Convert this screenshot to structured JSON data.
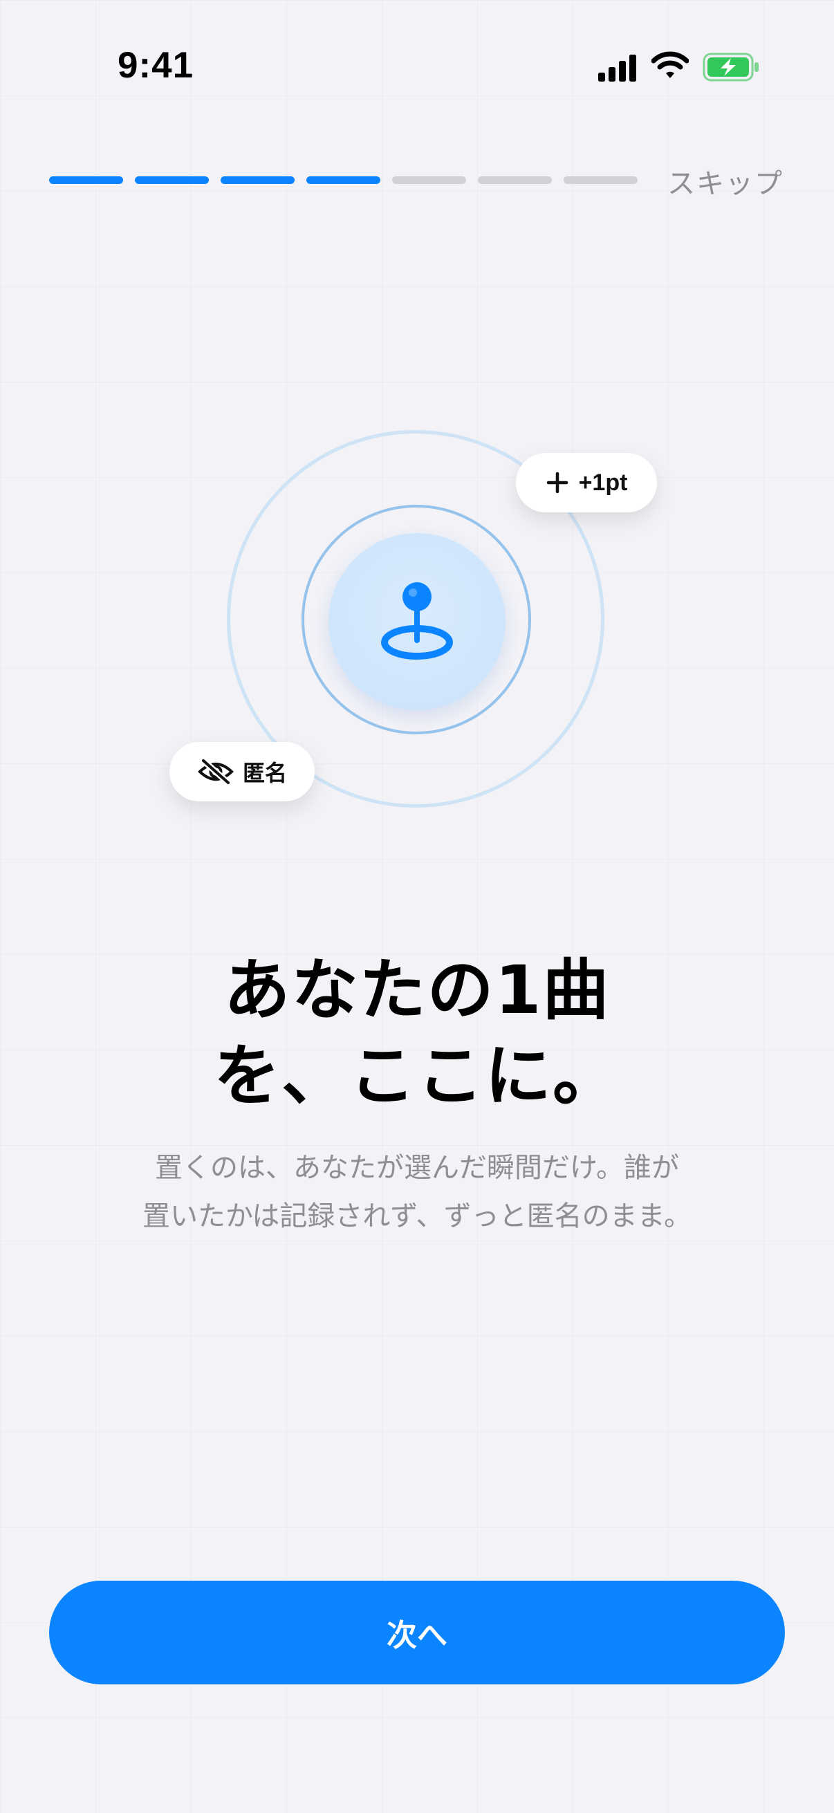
{
  "status_bar": {
    "time": "9:41",
    "icons": [
      "signal-icon",
      "wifi-icon",
      "battery-charging-icon"
    ]
  },
  "onboarding": {
    "total_steps": 7,
    "current_step": 4,
    "skip_label": "スキップ",
    "colors": {
      "active": "#0a84ff",
      "inactive": "#d1d1d6"
    }
  },
  "hero": {
    "center_icon": "map-pin-icon",
    "points_chip": {
      "icon": "plus-icon",
      "label": "+1pt"
    },
    "anon_chip": {
      "icon": "eye-slash-icon",
      "label": "匿名"
    }
  },
  "content": {
    "title_line1": "あなたの1曲",
    "title_line2": "を、ここに。",
    "subtitle_line1": "置くのは、あなたが選んだ瞬間だけ。誰が",
    "subtitle_line2": "置いたかは記録されず、ずっと匿名のまま。"
  },
  "actions": {
    "next_label": "次へ",
    "accent_color": "#0a84ff"
  }
}
